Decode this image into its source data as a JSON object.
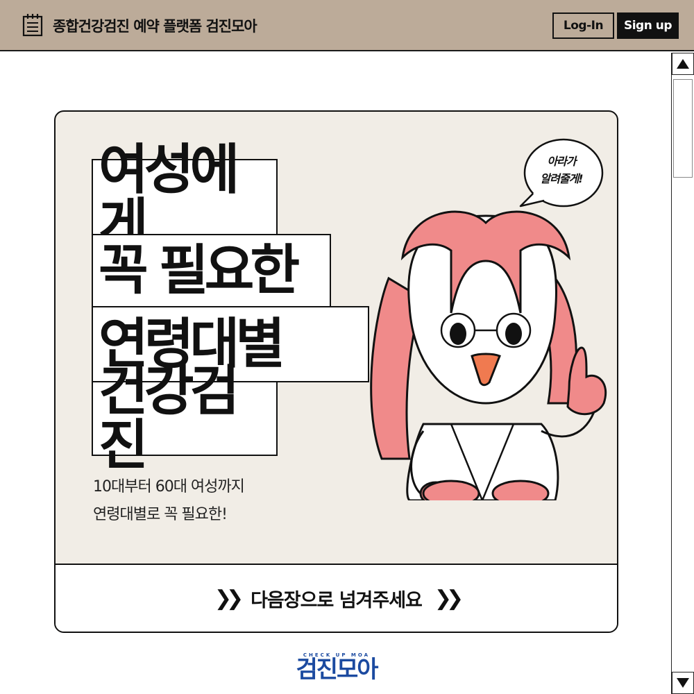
{
  "header": {
    "title": "종합건강검진 예약 플랫폼 검진모아",
    "menu_icon": "notepad-menu-icon",
    "login_label": "Log-In",
    "signup_label": "Sign up"
  },
  "banner": {
    "headline": [
      "여성에게",
      "꼭 필요한",
      "연령대별",
      "건강검진"
    ],
    "subtext": [
      "10대부터 60대 여성까지",
      "연령대별로 꼭 필요한!"
    ],
    "speech_bubble": [
      "아라가",
      "알려줄게!"
    ],
    "next_label": "다음장으로 넘겨주세요",
    "next_icon": "double-chevron-right-icon"
  },
  "footer": {
    "logo_tagline": "CHECK UP MOA",
    "logo_text": "검진모아"
  },
  "scrollbar": {
    "up_icon": "triangle-up-icon",
    "down_icon": "triangle-down-icon"
  },
  "colors": {
    "header_bg": "#bcab99",
    "card_bg": "#f1ede6",
    "character_pink": "#f08a8a",
    "logo_blue": "#1b4aa0"
  }
}
